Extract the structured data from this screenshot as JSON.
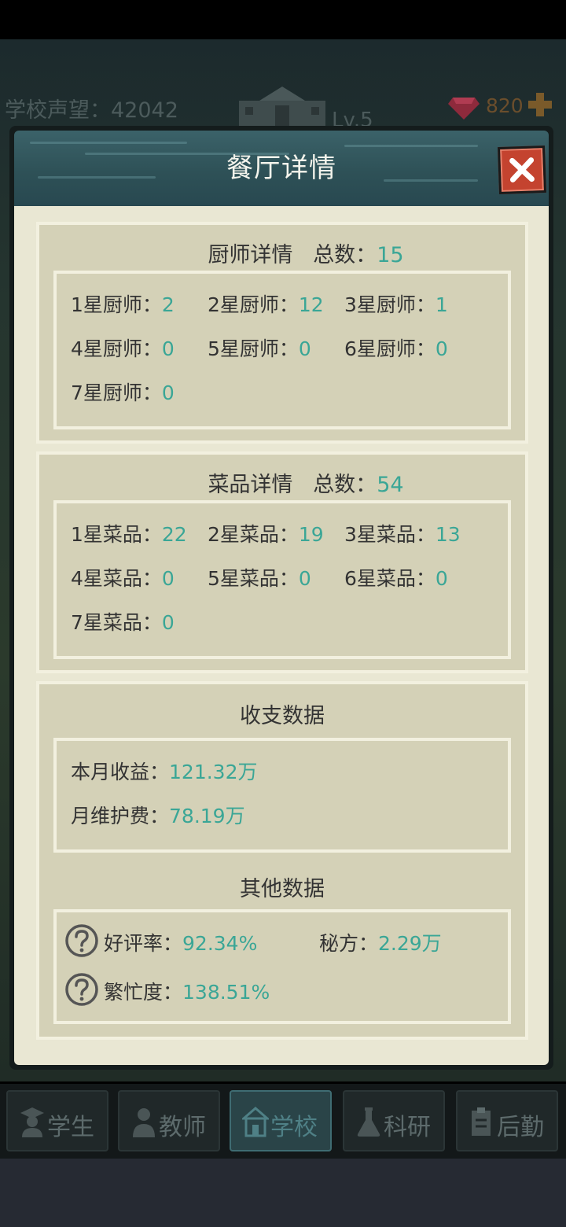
{
  "hud": {
    "reputation": "学校声望：42042",
    "level": "Lv.5",
    "gems": "820"
  },
  "dialog": {
    "title": "餐厅详情"
  },
  "chef": {
    "title": "厨师详情",
    "total_label": "总数：",
    "total": "15",
    "items": [
      {
        "label": "1星厨师：",
        "value": "2"
      },
      {
        "label": "2星厨师：",
        "value": "12"
      },
      {
        "label": "3星厨师：",
        "value": "1"
      },
      {
        "label": "4星厨师：",
        "value": "0"
      },
      {
        "label": "5星厨师：",
        "value": "0"
      },
      {
        "label": "6星厨师：",
        "value": "0"
      },
      {
        "label": "7星厨师：",
        "value": "0"
      }
    ]
  },
  "dish": {
    "title": "菜品详情",
    "total_label": "总数：",
    "total": "54",
    "items": [
      {
        "label": "1星菜品：",
        "value": "22"
      },
      {
        "label": "2星菜品：",
        "value": "19"
      },
      {
        "label": "3星菜品：",
        "value": "13"
      },
      {
        "label": "4星菜品：",
        "value": "0"
      },
      {
        "label": "5星菜品：",
        "value": "0"
      },
      {
        "label": "6星菜品：",
        "value": "0"
      },
      {
        "label": "7星菜品：",
        "value": "0"
      }
    ]
  },
  "finance": {
    "title": "收支数据",
    "income_label": "本月收益：",
    "income": "121.32万",
    "maintenance_label": "月维护费：",
    "maintenance": "78.19万"
  },
  "other": {
    "title": "其他数据",
    "rating_label": "好评率：",
    "rating": "92.34%",
    "recipe_label": "秘方：",
    "recipe": "2.29万",
    "busy_label": "繁忙度：",
    "busy": "138.51%"
  },
  "nav": [
    {
      "label": "学生",
      "icon": "student-icon"
    },
    {
      "label": "教师",
      "icon": "teacher-icon"
    },
    {
      "label": "学校",
      "icon": "school-icon"
    },
    {
      "label": "科研",
      "icon": "research-icon"
    },
    {
      "label": "后勤",
      "icon": "logistics-icon"
    }
  ],
  "colors": {
    "accent_value": "#3aa696",
    "header": "#2e5157",
    "close": "#c4432f",
    "panel": "#e9e7d3"
  }
}
